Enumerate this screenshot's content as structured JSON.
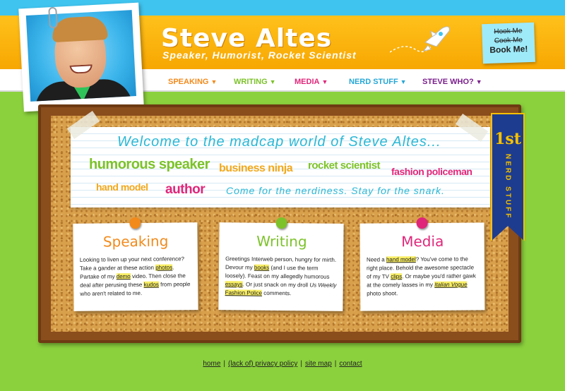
{
  "header": {
    "title": "Steve Altes",
    "tagline": "Speaker, Humorist, Rocket Scientist",
    "sticky": {
      "line1": "Hook Me",
      "line2": "Cook Me",
      "line3": "Book Me!"
    }
  },
  "nav": [
    {
      "label": "SPEAKING",
      "color": "#f28a1b"
    },
    {
      "label": "WRITING",
      "color": "#7cc22a"
    },
    {
      "label": "MEDIA",
      "color": "#e0267a"
    },
    {
      "label": "NERD STUFF",
      "color": "#27a7d6"
    },
    {
      "label": "STEVE WHO?",
      "color": "#7a1f8c"
    }
  ],
  "banner": {
    "welcome": "Welcome to the madcap world of Steve Altes...",
    "keywords": [
      "humorous speaker",
      "business ninja",
      "rocket scientist",
      "fashion policeman",
      "hand model",
      "author"
    ],
    "snark": "Come for the nerdiness. Stay for the snark."
  },
  "ribbon": {
    "place": "1st",
    "label": "NERD STUFF"
  },
  "cards": [
    {
      "title": "Speaking",
      "parts": [
        "Looking to liven up your next conference? Take a gander at these action ",
        "photos",
        ". Partake of my ",
        "demo",
        " video. Then close the deal after perusing these ",
        "kudos",
        " from people who aren't related to me."
      ]
    },
    {
      "title": "Writing",
      "parts": [
        "Greetings Interweb person, hungry for mirth. Devour my ",
        "books",
        " (and I use the term loosely). Feast on my allegedly humorous ",
        "essays",
        ". Or just snack on my droll ",
        "Us Weekly",
        " ",
        "Fashion Police",
        " comments."
      ]
    },
    {
      "title": "Media",
      "parts": [
        "Need a ",
        "hand model",
        "? You've come to the right place. Behold the awesome spectacle of my TV ",
        "clips",
        ". Or maybe you'd rather gawk at the comely lasses in my ",
        "Italian Vogue",
        " photo shoot."
      ]
    }
  ],
  "footer": {
    "links": [
      "home",
      "(lack of) privacy policy",
      "site map",
      "contact"
    ],
    "separator": "|"
  },
  "colors": {
    "background": "#8bd13d",
    "header": "#ffc11c",
    "cyan": "#2bb8d6",
    "speaking": "#f28a1b",
    "writing": "#7cc22a",
    "media": "#e0267a"
  }
}
